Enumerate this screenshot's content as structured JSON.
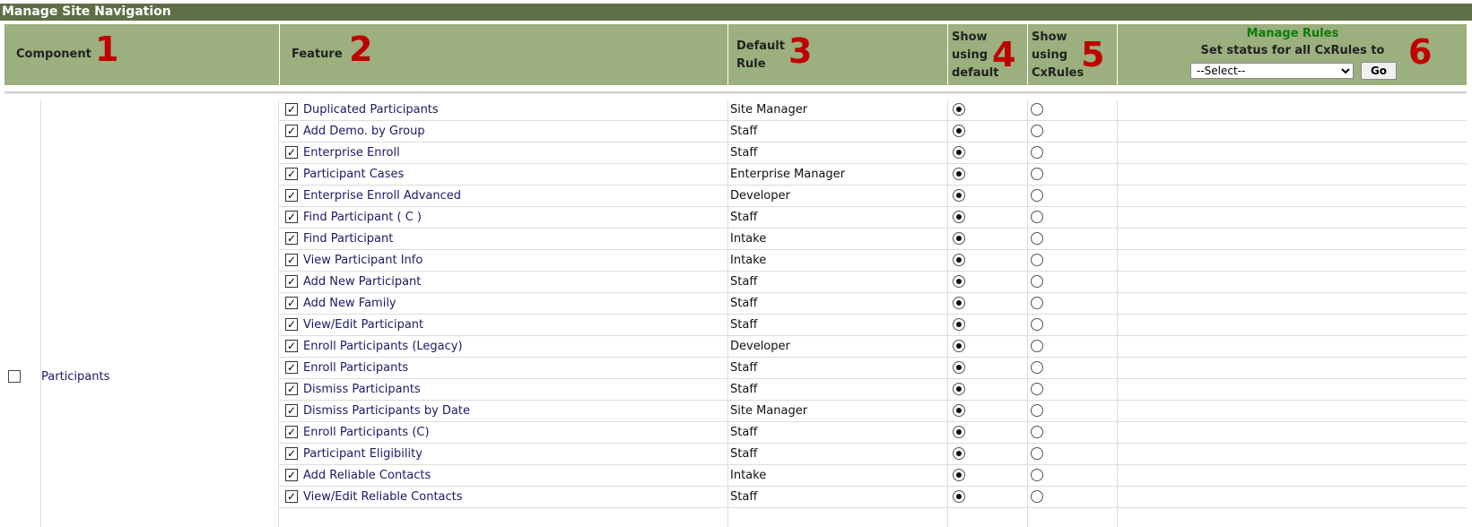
{
  "title": "Manage Site Navigation",
  "header": {
    "component": "Component",
    "feature": "Feature",
    "default_rule_1": "Default",
    "default_rule_2": "Rule",
    "show_default_1": "Show",
    "show_default_2": "using",
    "show_default_3": "default",
    "show_cx_1": "Show",
    "show_cx_2": "using",
    "show_cx_3": "CxRules",
    "manage_rules": "Manage Rules",
    "set_status": "Set status for all CxRules to",
    "select_value": "--Select--",
    "go_label": "Go",
    "markers": [
      "1",
      "2",
      "3",
      "4",
      "5",
      "6"
    ]
  },
  "component": {
    "label": "Participants",
    "checked": false
  },
  "rows": [
    {
      "feature": "Duplicated Participants",
      "rule": "Site Manager"
    },
    {
      "feature": "Add Demo. by Group",
      "rule": "Staff"
    },
    {
      "feature": "Enterprise Enroll",
      "rule": "Staff"
    },
    {
      "feature": "Participant Cases",
      "rule": "Enterprise Manager"
    },
    {
      "feature": "Enterprise Enroll Advanced",
      "rule": "Developer"
    },
    {
      "feature": "Find Participant ( C )",
      "rule": "Staff"
    },
    {
      "feature": "Find Participant",
      "rule": "Intake"
    },
    {
      "feature": "View Participant Info",
      "rule": "Intake"
    },
    {
      "feature": "Add New Participant",
      "rule": "Staff"
    },
    {
      "feature": "Add New Family",
      "rule": "Staff"
    },
    {
      "feature": "View/Edit Participant",
      "rule": "Staff"
    },
    {
      "feature": "Enroll Participants (Legacy)",
      "rule": "Developer"
    },
    {
      "feature": "Enroll Participants",
      "rule": "Staff"
    },
    {
      "feature": "Dismiss Participants",
      "rule": "Staff"
    },
    {
      "feature": "Dismiss Participants by Date",
      "rule": "Site Manager"
    },
    {
      "feature": "Enroll Participants (C)",
      "rule": "Staff"
    },
    {
      "feature": "Participant Eligibility",
      "rule": "Staff"
    },
    {
      "feature": "Add Reliable Contacts",
      "rule": "Intake"
    },
    {
      "feature": "View/Edit Reliable Contacts",
      "rule": "Staff"
    }
  ],
  "checkmark": "✓"
}
